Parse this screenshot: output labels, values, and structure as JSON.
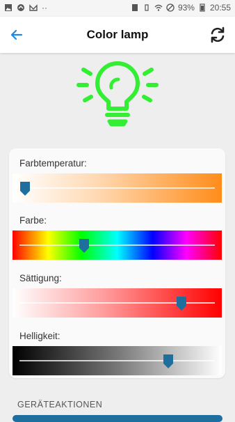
{
  "status_bar": {
    "battery_percent": "93%",
    "time": "20:55",
    "dots": "··"
  },
  "app_bar": {
    "title": "Color lamp"
  },
  "bulb": {
    "color": "#33ee33"
  },
  "sliders": [
    {
      "label": "Farbtemperatur:",
      "value": 0.03,
      "gradient": "linear-gradient(90deg, #ffffff 0%, #ffd9b3 40%, #ff8c1a 100%)"
    },
    {
      "label": "Farbe:",
      "value": 0.33,
      "gradient": "linear-gradient(90deg, #ff0000 0%, #ffff00 17%, #00ff00 33%, #00ffff 50%, #0000ff 67%, #ff00ff 83%, #ff0000 100%)"
    },
    {
      "label": "Sättigung:",
      "value": 0.83,
      "gradient": "linear-gradient(90deg, #ffffff 0%, #ff9999 45%, #ff0000 100%)"
    },
    {
      "label": "Helligkeit:",
      "value": 0.76,
      "gradient": "linear-gradient(90deg, #000000 0%, #777777 50%, #ffffff 100%)"
    }
  ],
  "section": {
    "title": "GERÄTEAKTIONEN"
  },
  "colors": {
    "accent": "#1e88e5",
    "thumb": "#1e6f9e"
  },
  "icons": [
    "back-arrow-icon",
    "refresh-icon",
    "lightbulb-icon"
  ]
}
